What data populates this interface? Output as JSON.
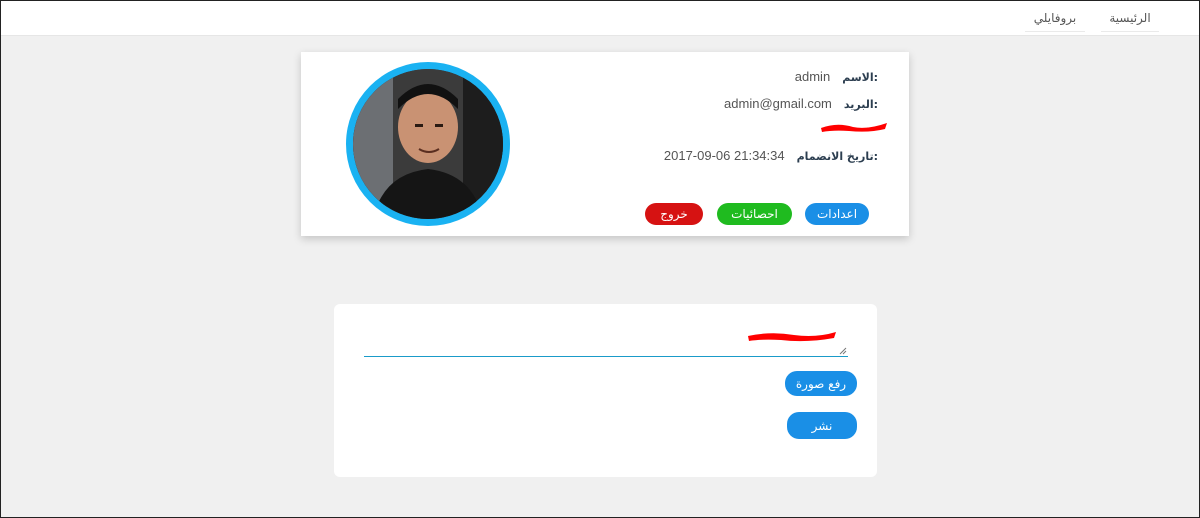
{
  "nav": {
    "home_label": "الرئيسية",
    "profile_label": "بروفايلي"
  },
  "profile": {
    "name_label": "الاسم:",
    "name_value": "admin",
    "email_label": "البريد:",
    "email_value": "admin@gmail.com",
    "joined_label": "تاريخ الانضمام:",
    "joined_value": "2017-09-06 21:34:34",
    "buttons": {
      "settings": "اعدادات",
      "stats": "احصائيات",
      "logout": "خروج"
    }
  },
  "post": {
    "upload_label": "رفع صورة",
    "publish_label": "نشر"
  },
  "colors": {
    "primary": "#1a8fe6",
    "success": "#1fbb1f",
    "danger": "#d61212",
    "avatar_ring": "#1ab2f2",
    "redaction": "#ff0000"
  }
}
